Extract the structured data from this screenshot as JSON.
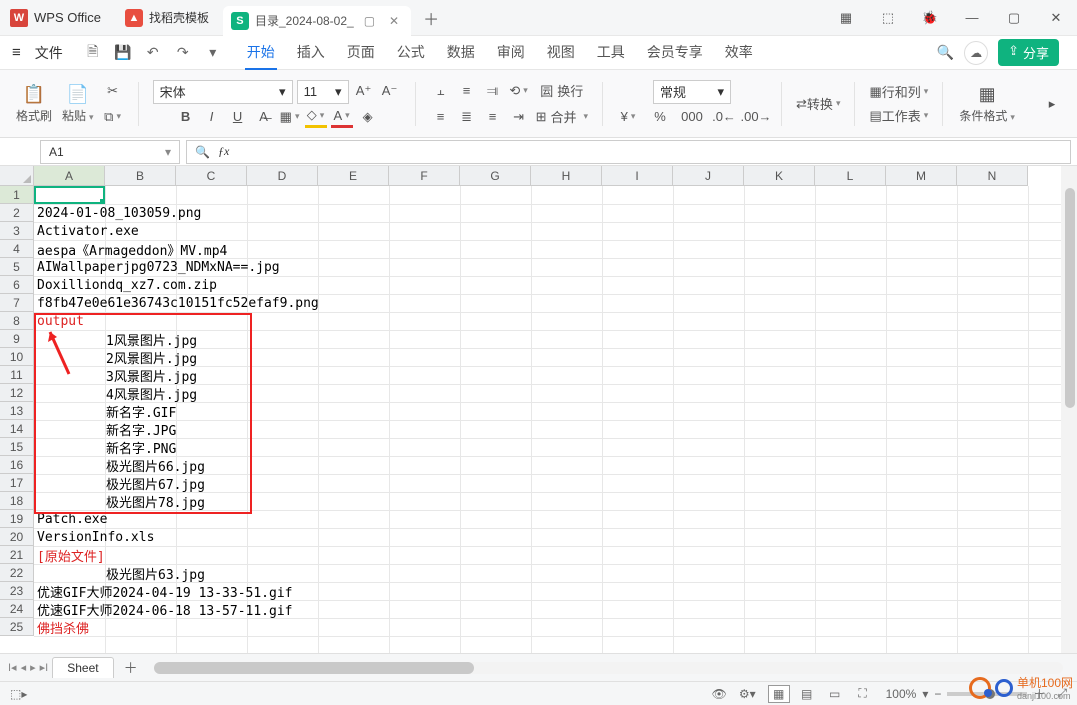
{
  "brand": "WPS Office",
  "template_tab": "找稻壳模板",
  "doc_tab": "目录_2024-08-02_",
  "file_menu": "文件",
  "menu_tabs": [
    "开始",
    "插入",
    "页面",
    "公式",
    "数据",
    "审阅",
    "视图",
    "工具",
    "会员专享",
    "效率"
  ],
  "menu_active": 0,
  "share": "分享",
  "ribbon": {
    "format_brush": "格式刷",
    "paste": "粘贴",
    "font_name": "宋体",
    "font_size": "11",
    "wrap": "换行",
    "merge": "合并",
    "number_format": "常规",
    "transpose": "转换",
    "rowscols": "行和列",
    "worksheet": "工作表",
    "cond_format": "条件格式"
  },
  "namebox": "A1",
  "columns": [
    "A",
    "B",
    "C",
    "D",
    "E",
    "F",
    "G",
    "H",
    "I",
    "J",
    "K",
    "L",
    "M",
    "N"
  ],
  "rows_shown": 25,
  "selected": {
    "row": 1,
    "col": "A"
  },
  "sheet_tab": "Sheet",
  "status": {
    "zoom": "100%"
  },
  "footer_site": "单机100网",
  "footer_site_url": "danji100.com",
  "cell_data": {
    "A2": "2024-01-08_103059.png",
    "A3": "Activator.exe",
    "A4": "aespa《Armageddon》MV.mp4",
    "A5": "AIWallpaperjpg0723_NDMxNA==.jpg",
    "A6": "Doxilliondq_xz7.com.zip",
    "A7": "f8fb47e0e61e36743c10151fc52efaf9.png",
    "A8": "output",
    "B9": "1风景图片.jpg",
    "B10": "2风景图片.jpg",
    "B11": "3风景图片.jpg",
    "B12": "4风景图片.jpg",
    "B13": "新名字.GIF",
    "B14": "新名字.JPG",
    "B15": "新名字.PNG",
    "B16": "极光图片66.jpg",
    "B17": "极光图片67.jpg",
    "B18": "极光图片78.jpg",
    "A19": "Patch.exe",
    "A20": "VersionInfo.xls",
    "A21": "[原始文件]",
    "B22": "极光图片63.jpg",
    "A23": "优速GIF大师2024-04-19 13-33-51.gif",
    "A24": "优速GIF大师2024-06-18 13-57-11.gif",
    "A25": "佛挡杀佛"
  },
  "red_cells": [
    "A8",
    "A21",
    "A25"
  ]
}
